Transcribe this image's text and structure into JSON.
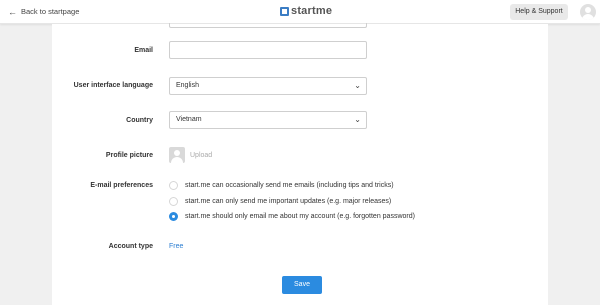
{
  "header": {
    "back_label": "Back to startpage",
    "logo_text": "startme",
    "help_label": "Help & Support"
  },
  "form": {
    "email": {
      "label": "Email",
      "value": ""
    },
    "language": {
      "label": "User interface language",
      "value": "English"
    },
    "country": {
      "label": "Country",
      "value": "Vietnam"
    },
    "profile_picture": {
      "label": "Profile picture",
      "upload_label": "Upload"
    },
    "email_preferences": {
      "label": "E-mail preferences",
      "options": [
        {
          "label": "start.me can occasionally send me emails (including tips and tricks)",
          "selected": false
        },
        {
          "label": "start.me can only send me important updates (e.g. major releases)",
          "selected": false
        },
        {
          "label": "start.me should only email me about my account (e.g. forgotten password)",
          "selected": true
        }
      ]
    },
    "account_type": {
      "label": "Account type",
      "value": "Free"
    },
    "save_label": "Save"
  },
  "colors": {
    "accent": "#2b8be0",
    "link": "#2b7dd1",
    "background": "#f0f0f0"
  },
  "icons": [
    "arrow-left-icon",
    "startme-logo-icon",
    "user-avatar-icon",
    "chevron-down-icon",
    "profile-placeholder-icon"
  ]
}
